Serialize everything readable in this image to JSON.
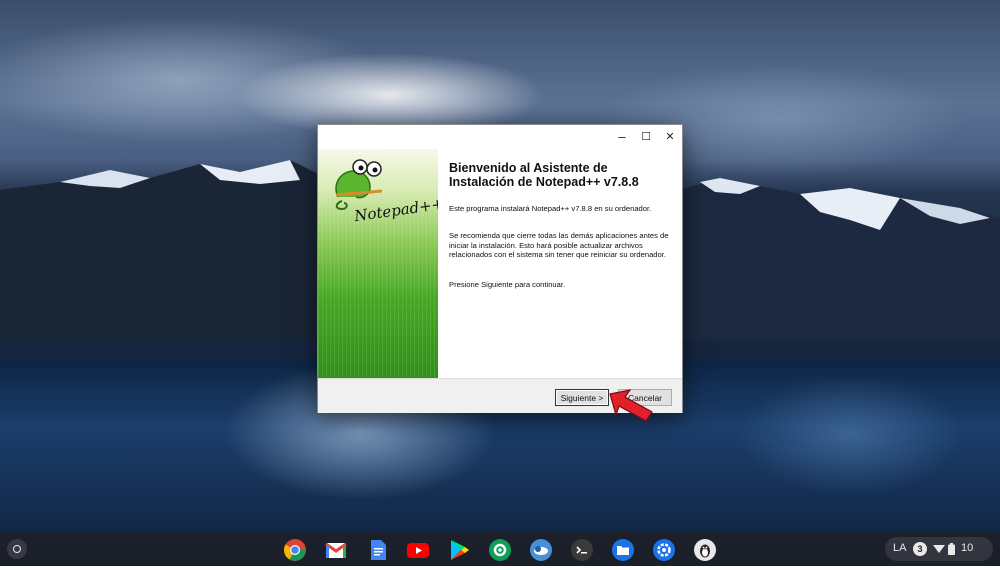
{
  "window": {
    "title": "",
    "controls": {
      "minimize": "–",
      "maximize": "☐",
      "close": "✕"
    },
    "logo_text": "Notepad++",
    "heading": "Bienvenido al Asistente de Instalación de Notepad++ v7.8.8",
    "paragraphs": [
      "Este programa instalará Notepad++ v7.8.8 en su ordenador.",
      "Se recomienda que cierre todas las demás aplicaciones antes de iniciar la instalación. Esto hará posible actualizar archivos relacionados con el sistema sin tener que reiniciar su ordenador.",
      "Presione Siguiente para continuar."
    ],
    "buttons": {
      "next": "Siguiente >",
      "cancel": "Cancelar"
    }
  },
  "taskbar": {
    "apps": [
      "chrome-icon",
      "gmail-icon",
      "docs-icon",
      "youtube-icon",
      "play-store-icon",
      "settings-app-icon",
      "remote-app-icon",
      "terminal-icon",
      "files-icon",
      "settings-icon",
      "linux-penguin-icon"
    ],
    "tray": {
      "keyboard": "LA",
      "notifications": "3",
      "time": "10"
    }
  },
  "colors": {
    "accent_green": "#46a823",
    "taskbar": "#1c2028",
    "cursor_red": "#e0202a"
  }
}
